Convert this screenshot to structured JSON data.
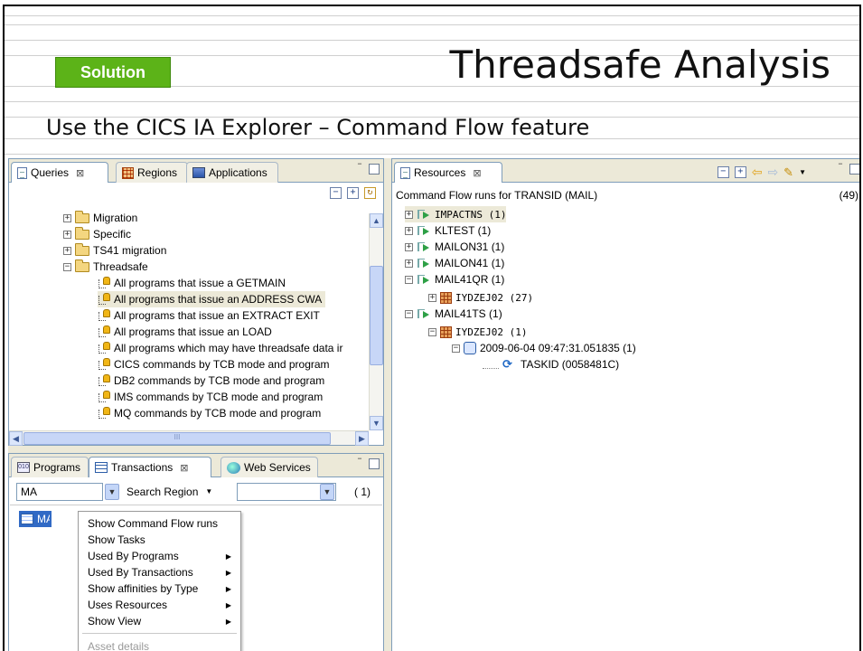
{
  "slide": {
    "badge": "Solution",
    "title": "Threadsafe Analysis",
    "subtitle": "Use the CICS IA Explorer – Command Flow feature"
  },
  "queries_panel": {
    "tabs": [
      {
        "label": "Queries",
        "icon": "document-icon"
      },
      {
        "label": "Regions",
        "icon": "regions-grid-icon"
      },
      {
        "label": "Applications",
        "icon": "applications-icon"
      }
    ],
    "tree": [
      {
        "label": "Migration",
        "kind": "folder",
        "expander": "+"
      },
      {
        "label": "Specific",
        "kind": "folder",
        "expander": "+"
      },
      {
        "label": "TS41 migration",
        "kind": "folder",
        "expander": "+"
      },
      {
        "label": "Threadsafe",
        "kind": "folder",
        "expander": "-"
      },
      {
        "label": "All programs that issue a GETMAIN",
        "kind": "query"
      },
      {
        "label": "All programs that issue an ADDRESS CWA",
        "kind": "query"
      },
      {
        "label": "All programs that issue an EXTRACT EXIT",
        "kind": "query"
      },
      {
        "label": "All programs that issue an LOAD",
        "kind": "query"
      },
      {
        "label": "All programs which may have threadsafe data ir",
        "kind": "query"
      },
      {
        "label": "CICS commands by TCB mode and program",
        "kind": "query"
      },
      {
        "label": "DB2 commands by TCB mode and program",
        "kind": "query"
      },
      {
        "label": "IMS commands by TCB mode and program",
        "kind": "query"
      },
      {
        "label": "MQ commands by TCB mode and program",
        "kind": "query"
      }
    ],
    "hscroll_grip": "III"
  },
  "transactions_panel": {
    "tabs": [
      {
        "label": "Programs",
        "icon": "programs-icon"
      },
      {
        "label": "Transactions",
        "icon": "table-icon"
      },
      {
        "label": "Web Services",
        "icon": "web-services-icon"
      }
    ],
    "filter_value": "MA",
    "search_label": "Search Region",
    "count": "( 1)",
    "list_item": "MAIL",
    "context_menu": {
      "items": [
        {
          "label": "Show Command Flow runs",
          "submenu": false,
          "disabled": false
        },
        {
          "label": "Show Tasks",
          "submenu": false,
          "disabled": false
        },
        {
          "label": "Used By Programs",
          "submenu": true,
          "disabled": false
        },
        {
          "label": "Used By Transactions",
          "submenu": true,
          "disabled": false
        },
        {
          "label": "Show affinities by Type",
          "submenu": true,
          "disabled": false
        },
        {
          "label": "Uses Resources",
          "submenu": true,
          "disabled": false
        },
        {
          "label": "Show View",
          "submenu": true,
          "disabled": false
        },
        {
          "label": "Asset details",
          "submenu": false,
          "disabled": true
        }
      ]
    }
  },
  "resources_panel": {
    "tab": "Resources",
    "header": "Command Flow runs for TRANSID (MAIL)",
    "count": "(49)",
    "tree": [
      {
        "label": "IMPACTNS  (1)",
        "kind": "run",
        "expander": "+",
        "depth": 0
      },
      {
        "label": "KLTEST  (1)",
        "kind": "run",
        "expander": "+",
        "depth": 0
      },
      {
        "label": "MAILON31  (1)",
        "kind": "run",
        "expander": "+",
        "depth": 0
      },
      {
        "label": "MAILON41  (1)",
        "kind": "run",
        "expander": "+",
        "depth": 0
      },
      {
        "label": "MAIL41QR  (1)",
        "kind": "run",
        "expander": "-",
        "depth": 0
      },
      {
        "label": "IYDZEJ02  (27)",
        "kind": "region",
        "expander": "+",
        "depth": 1
      },
      {
        "label": "MAIL41TS  (1)",
        "kind": "run",
        "expander": "-",
        "depth": 0
      },
      {
        "label": "IYDZEJ02  (1)",
        "kind": "region",
        "expander": "-",
        "depth": 1
      },
      {
        "label": "2009-06-04 09:47:31.051835  (1)",
        "kind": "time",
        "expander": "-",
        "depth": 2
      },
      {
        "label": "TASKID (0058481C)",
        "kind": "task",
        "expander": "",
        "depth": 3
      }
    ]
  },
  "colors": {
    "badge_green": "#5cb318",
    "eclipse_chrome": "#ece9d8",
    "selection_blue": "#316ac5"
  }
}
